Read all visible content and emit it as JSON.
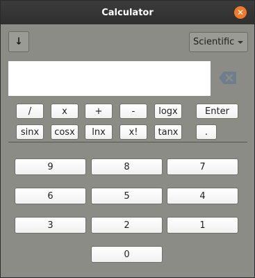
{
  "window": {
    "title": "Calculator"
  },
  "toolbar": {
    "history_label": "↓",
    "mode_selected": "Scientific"
  },
  "display": {
    "value": ""
  },
  "icons": {
    "close": "close-icon",
    "backspace": "backspace-icon",
    "dropdown": "chevron-down-icon"
  },
  "colors": {
    "close": "#f07a2a",
    "window_bg": "#8c8c86"
  },
  "ops": {
    "row1": [
      "/",
      "x",
      "+",
      "-",
      "logx",
      "Enter"
    ],
    "row2": [
      "sinx",
      "cosx",
      "lnx",
      "x!",
      "tanx",
      "."
    ]
  },
  "keypad": {
    "row1": [
      "9",
      "8",
      "7"
    ],
    "row2": [
      "6",
      "5",
      "4"
    ],
    "row3": [
      "3",
      "2",
      "1"
    ],
    "row4": [
      "0"
    ]
  }
}
